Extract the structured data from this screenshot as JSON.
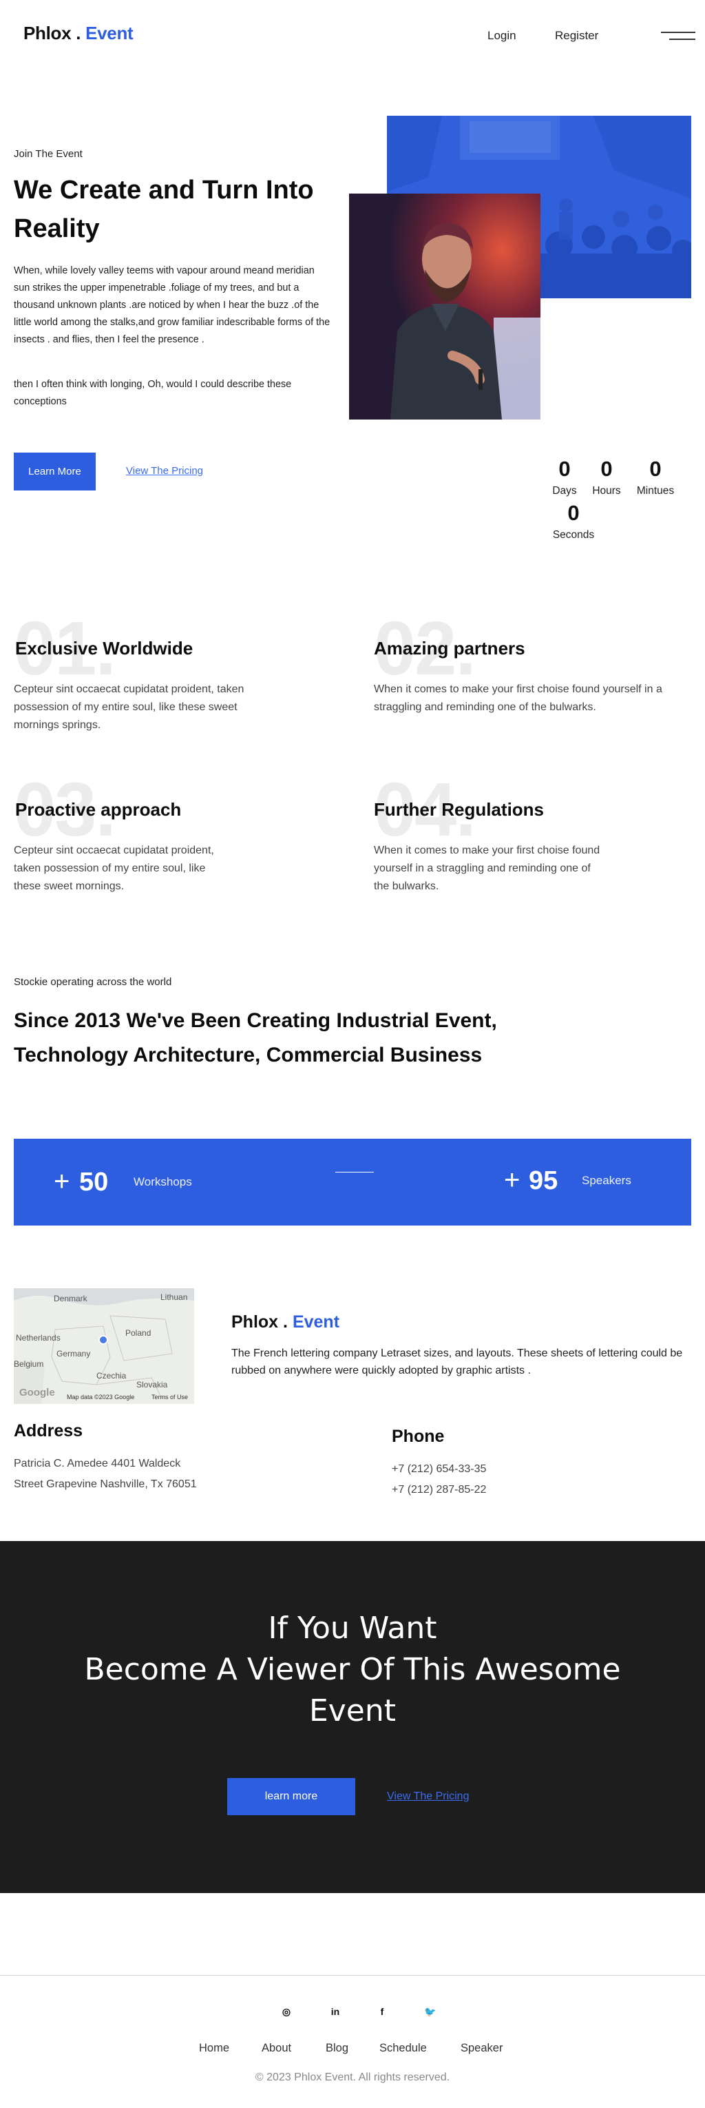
{
  "header": {
    "logo_main": "Phlox",
    "logo_dot": ".",
    "logo_accent": "Event",
    "nav": {
      "login": "Login",
      "register": "Register"
    }
  },
  "hero": {
    "eyebrow": "Join The Event",
    "title": "We Create and Turn Into Reality",
    "paragraph1": "When, while lovely valley teems with vapour around meand meridian sun strikes the upper impenetrable .foliage of my trees, and but a thousand unknown plants .are noticed by when I hear the buzz .of the little world among the stalks,and grow familiar indescribable forms of the insects . and flies, then I feel the presence .",
    "paragraph2": "then I often think with longing, Oh, would I could describe these conceptions",
    "learn_more": "Learn More",
    "view_pricing": "View The Pricing"
  },
  "countdown": {
    "days": {
      "value": "0",
      "label": "Days"
    },
    "hours": {
      "value": "0",
      "label": "Hours"
    },
    "minutes": {
      "value": "0",
      "label": "Mintues"
    },
    "seconds": {
      "value": "0",
      "label": "Seconds"
    }
  },
  "features": [
    {
      "number": "01.",
      "title": "Exclusive Worldwide",
      "text": "Cepteur sint occaecat cupidatat proident, taken possession of my entire soul, like these sweet mornings springs."
    },
    {
      "number": "02.",
      "title": "Amazing partners",
      "text": "When it comes to make your first choise found yourself in a straggling and reminding one of the bulwarks."
    },
    {
      "number": "03.",
      "title": "Proactive approach",
      "text": "Cepteur sint occaecat cupidatat proident, taken possession of my entire soul, like these sweet mornings."
    },
    {
      "number": "04.",
      "title": "Further Regulations",
      "text": "When it comes to make your first choise found yourself in a straggling and reminding one of the bulwarks."
    }
  ],
  "stats": {
    "eyebrow": "Stockie operating across the world",
    "title": "Since 2013 We've Been Creating Industrial Event, Technology Architecture, Commercial Business",
    "workshops": {
      "plus": "+",
      "value": "50",
      "label": "Workshops"
    },
    "speakers": {
      "plus": "+",
      "value": "95",
      "label": "Speakers"
    }
  },
  "map": {
    "labels": {
      "denmark": "Denmark",
      "lithuania": "Lithuan",
      "netherlands": "Netherlands",
      "poland": "Poland",
      "germany": "Germany",
      "belgium": "Belgium",
      "czechia": "Czechia",
      "slovakia": "Slovakia"
    },
    "attribution": "Map data ©2023 Google",
    "terms": "Terms of Use",
    "google": "Google"
  },
  "contact": {
    "brand_main": "Phlox",
    "brand_dot": ".",
    "brand_accent": "Event",
    "text": "The French lettering company Letraset sizes, and layouts. These sheets of lettering could be rubbed on anywhere were quickly adopted by graphic artists .",
    "address_title": "Address",
    "address_line1": "Patricia C. Amedee 4401 Waldeck",
    "address_line2": "Street Grapevine Nashville, Tx 76051",
    "phone_title": "Phone",
    "phone1": "+7 (212) 654-33-35",
    "phone2": "+7 (212) 287-85-22"
  },
  "cta": {
    "line1": "If You Want",
    "line2": "Become A Viewer Of This Awesome",
    "line3": "Event",
    "button": "learn more",
    "link": "View The Pricing"
  },
  "footer": {
    "social": [
      {
        "name": "instagram-icon",
        "glyph": "◎"
      },
      {
        "name": "linkedin-icon",
        "glyph": "in"
      },
      {
        "name": "facebook-icon",
        "glyph": "f"
      },
      {
        "name": "twitter-icon",
        "glyph": "🐦"
      }
    ],
    "nav": [
      "Home",
      "About",
      "Blog",
      "Schedule",
      "Speaker"
    ],
    "copyright": "© 2023 Phlox Event. All rights reserved."
  },
  "colors": {
    "accent": "#2e5ee0",
    "dark": "#1d1d1d"
  }
}
